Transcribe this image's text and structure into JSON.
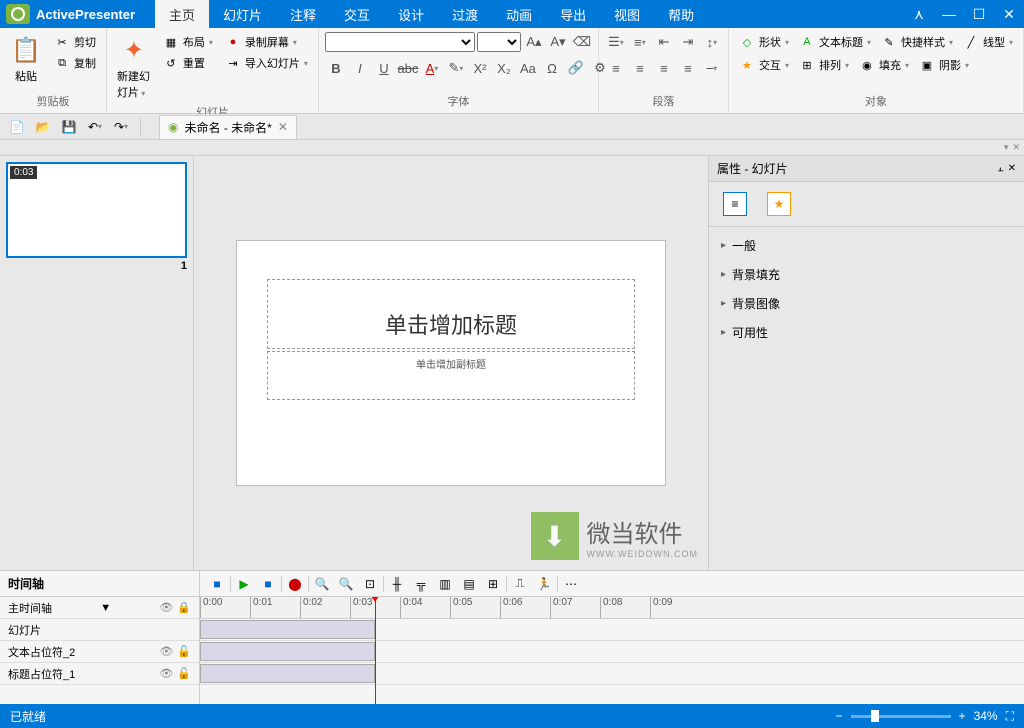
{
  "app": {
    "name": "ActivePresenter"
  },
  "menu": {
    "tabs": [
      "主页",
      "幻灯片",
      "注释",
      "交互",
      "设计",
      "过渡",
      "动画",
      "导出",
      "视图",
      "帮助"
    ],
    "active": 0
  },
  "ribbon": {
    "clipboard": {
      "paste": "粘贴",
      "cut": "剪切",
      "copy": "复制",
      "label": "剪贴板"
    },
    "slides": {
      "new": "新建幻灯片",
      "layout": "布局",
      "record": "录制屏幕",
      "reset": "重置",
      "import": "导入幻灯片",
      "label": "幻灯片"
    },
    "font": {
      "label": "字体"
    },
    "paragraph": {
      "label": "段落"
    },
    "objects": {
      "shape": "形状",
      "caption": "文本标题",
      "quick": "快捷样式",
      "line": "线型",
      "interact": "交互",
      "arrange": "排列",
      "fill": "填充",
      "shadow": "阴影",
      "label": "对象"
    }
  },
  "doc": {
    "title": "未命名 - 未命名*"
  },
  "slide": {
    "time": "0:03",
    "number": "1",
    "title_ph": "单击增加标题",
    "subtitle_ph": "单击增加副标题"
  },
  "props": {
    "header": "属性  -  幻灯片",
    "items": [
      "一般",
      "背景填充",
      "背景图像",
      "可用性"
    ]
  },
  "timeline": {
    "title": "时间轴",
    "main_track": "主时间轴",
    "tracks": [
      "幻灯片",
      "文本占位符_2",
      "标题占位符_1"
    ],
    "ticks": [
      "0:00",
      "0:01",
      "0:02",
      "0:03",
      "0:04",
      "0:05",
      "0:06",
      "0:07",
      "0:08",
      "0:09"
    ]
  },
  "status": {
    "ready": "已就绪",
    "zoom": "34%"
  },
  "watermark": {
    "text": "微当软件",
    "sub": "WWW.WEIDOWN.COM"
  }
}
